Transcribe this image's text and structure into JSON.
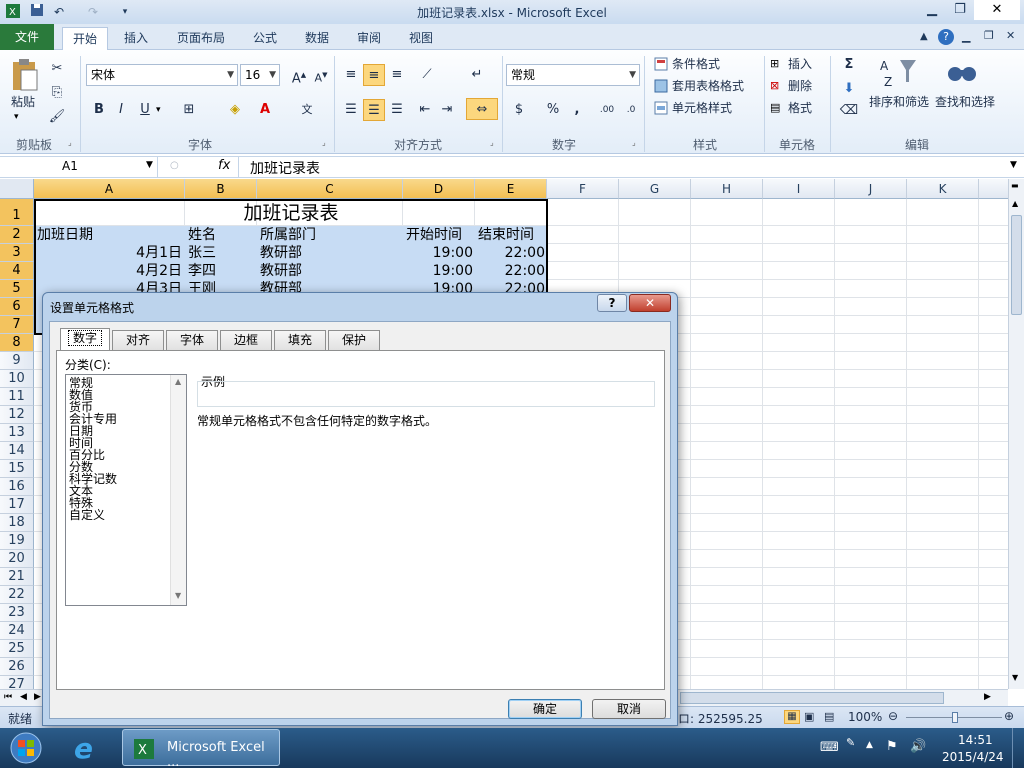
{
  "window": {
    "title": "加班记录表.xlsx - Microsoft Excel"
  },
  "ribbon": {
    "tabs": [
      "文件",
      "开始",
      "插入",
      "页面布局",
      "公式",
      "数据",
      "审阅",
      "视图"
    ],
    "clipboard": {
      "paste_label": "粘贴",
      "group": "剪贴板"
    },
    "font": {
      "name": "宋体",
      "size": "16",
      "group": "字体",
      "bold": "B",
      "italic": "I",
      "underline": "U"
    },
    "alignment": {
      "group": "对齐方式"
    },
    "number": {
      "format": "常规",
      "group": "数字",
      "percent": "%",
      "comma": ","
    },
    "styles": {
      "group": "样式",
      "cond_format": "条件格式",
      "table_format": "套用表格格式",
      "cell_styles": "单元格样式"
    },
    "cells": {
      "group": "单元格",
      "insert": "插入",
      "delete": "删除",
      "format": "格式"
    },
    "editing": {
      "group": "编辑",
      "sort_filter": "排序和筛选",
      "find_select": "查找和选择",
      "sigma": "Σ"
    }
  },
  "formula_bar": {
    "name_box": "A1",
    "fx": "fx",
    "content": "加班记录表"
  },
  "grid": {
    "columns": [
      "A",
      "B",
      "C",
      "D",
      "E",
      "F",
      "G",
      "H",
      "I",
      "J",
      "K"
    ],
    "rows": [
      "1",
      "2",
      "3",
      "4",
      "5",
      "6",
      "7",
      "8",
      "9",
      "10",
      "11",
      "12",
      "13",
      "14",
      "15",
      "16",
      "17",
      "18",
      "19",
      "20",
      "21",
      "22",
      "23",
      "24",
      "25",
      "26",
      "27"
    ],
    "title": "加班记录表",
    "headers": [
      "加班日期",
      "姓名",
      "所属部门",
      "开始时间",
      "结束时间"
    ],
    "data": [
      [
        "4月1日",
        "张三",
        "教研部",
        "19:00",
        "22:00"
      ],
      [
        "4月2日",
        "李四",
        "教研部",
        "19:00",
        "22:00"
      ],
      [
        "4月3日",
        "王刚",
        "教研部",
        "19:00",
        "22:00"
      ]
    ]
  },
  "status": {
    "ready": "就绪",
    "count_partial": "ロ: 252595.25",
    "zoom": "100%"
  },
  "dialog": {
    "title": "设置单元格格式",
    "help": "?",
    "tabs": [
      "数字",
      "对齐",
      "字体",
      "边框",
      "填充",
      "保护"
    ],
    "category_label": "分类(C):",
    "categories": [
      "常规",
      "数值",
      "货币",
      "会计专用",
      "日期",
      "时间",
      "百分比",
      "分数",
      "科学记数",
      "文本",
      "特殊",
      "自定义"
    ],
    "sample_label": "示例",
    "description": "常规单元格格式不包含任何特定的数字格式。",
    "ok": "确定",
    "cancel": "取消"
  },
  "taskbar": {
    "app_button": "Microsoft Excel ...",
    "time": "14:51",
    "date": "2015/4/24"
  }
}
